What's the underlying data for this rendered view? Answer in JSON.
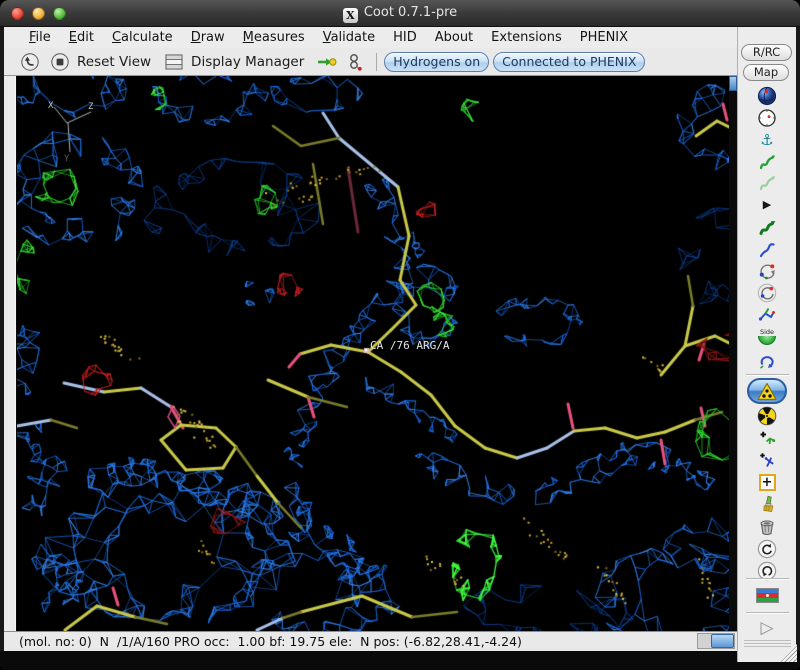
{
  "window": {
    "title": "Coot 0.7.1-pre"
  },
  "menu": {
    "items": [
      "File",
      "Edit",
      "Calculate",
      "Draw",
      "Measures",
      "Validate",
      "HID",
      "About",
      "Extensions",
      "PHENIX"
    ]
  },
  "toolbar": {
    "reset_view_label": "Reset View",
    "display_manager_label": "Display Manager",
    "hydrogens_label": "Hydrogens on",
    "phenix_label": "Connected to PHENIX"
  },
  "side_panel": {
    "rrc_label": "R/RC",
    "map_label": "Map",
    "side_flip_label": "Side",
    "tools": [
      "sphere-view",
      "recenter-clock",
      "fixed-atoms-anchor",
      "real-space-refine",
      "regularize-zone",
      "accept-play",
      "auto-fit-rotamer",
      "rotamers",
      "edit-chi-angles",
      "torsion-general",
      "edit-backbone-torsion",
      "side-chain-180-flip",
      "jed-flip",
      "mutate-autofit-active",
      "radiation-mutate",
      "add-terminal-residue",
      "add-alt-conf",
      "place-atom",
      "simple-mutate-brush",
      "delete-item",
      "undo",
      "redo",
      "run-refmac-flag",
      "more-tools"
    ]
  },
  "viewport": {
    "atom_label": "CA /76 ARG/A",
    "axis_labels": {
      "x": "X",
      "y": "Y",
      "z": "Z"
    },
    "colors": {
      "background": "#000000",
      "density_2fofc": "#1a6ae0",
      "density_2fofc_light": "#3f8cf0",
      "density_dim": "#0c3f8f",
      "diff_positive": "#27c427",
      "diff_positive_bright": "#46ff46",
      "diff_negative": "#cc2222",
      "diff_negative_dim": "#8a1818",
      "stick_carbon": "#c9c94a",
      "stick_carbon_dark": "#7c7c2c",
      "stick_nitrogen": "#a9c2ea",
      "stick_oxygen": "#e8527e",
      "stick_shadow": "#6a2838",
      "dots": "#c9a52e"
    }
  },
  "statusbar": {
    "text": "(mol. no: 0)  N  /1/A/160 PRO occ:  1.00 bf: 19.75 ele:  N pos: (-6.82,28.41,-4.24)"
  }
}
